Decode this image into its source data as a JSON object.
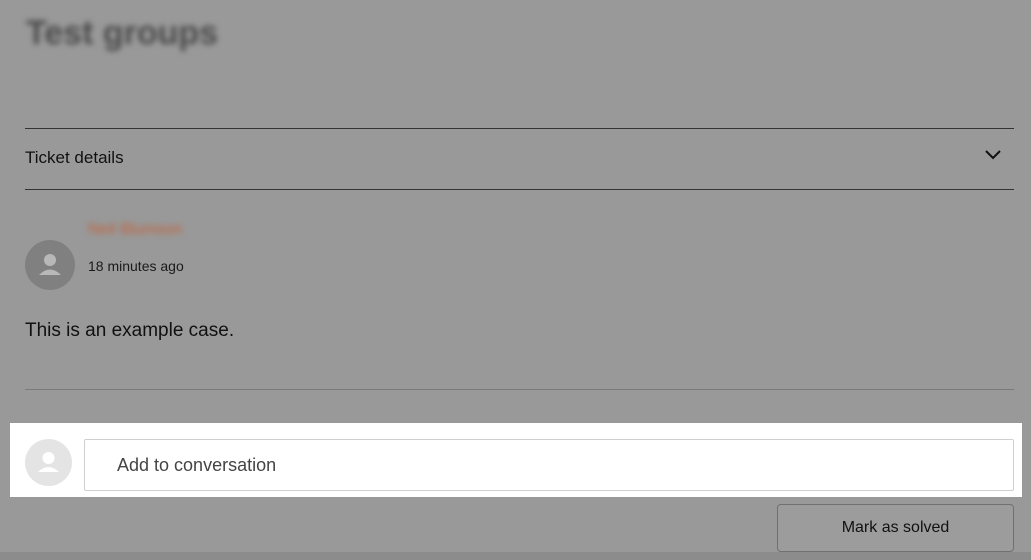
{
  "page": {
    "title": "Test groups"
  },
  "ticket_details": {
    "label": "Ticket details",
    "toggle_icon": "chevron-down-icon"
  },
  "comment": {
    "author": "Neil Blumson",
    "time": "18 minutes ago",
    "body": "This is an example case.",
    "avatar_icon": "user-avatar-icon"
  },
  "compose": {
    "placeholder": "Add to conversation",
    "avatar_icon": "user-avatar-icon"
  },
  "actions": {
    "mark_solved_label": "Mark as solved"
  },
  "colors": {
    "overlay": "#999999",
    "author_link": "#c0623a",
    "compose_bg": "#ffffff"
  }
}
